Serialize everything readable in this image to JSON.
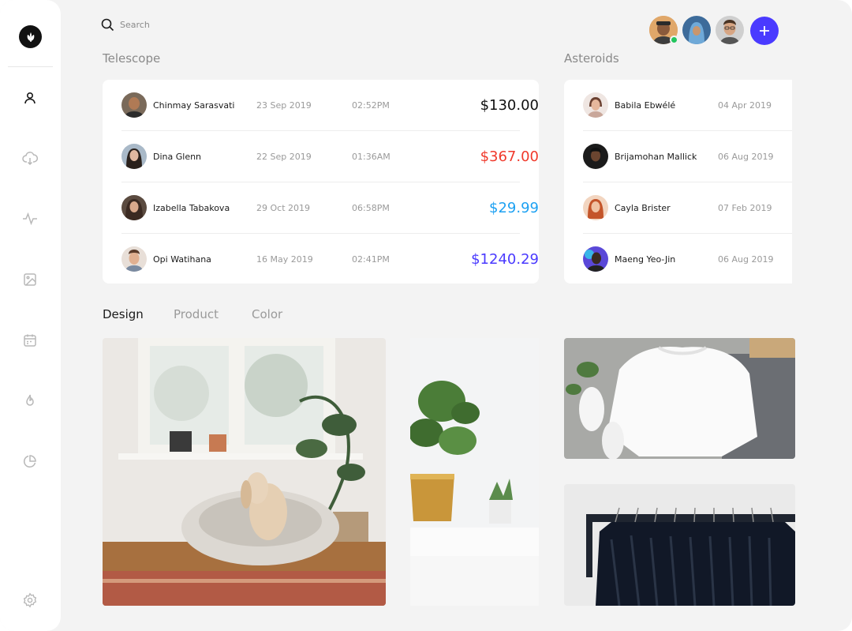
{
  "search": {
    "placeholder": "Search"
  },
  "sidebar": {
    "items": [
      {
        "icon": "user-icon"
      },
      {
        "icon": "cloud-download-icon"
      },
      {
        "icon": "activity-icon"
      },
      {
        "icon": "image-icon"
      },
      {
        "icon": "calendar-icon"
      },
      {
        "icon": "flame-icon"
      },
      {
        "icon": "pie-chart-icon"
      },
      {
        "icon": "settings-icon"
      }
    ]
  },
  "header": {
    "avatars": [
      "avatar-1",
      "avatar-2",
      "avatar-3"
    ],
    "add_icon": "plus-icon"
  },
  "telescope": {
    "title": "Telescope",
    "rows": [
      {
        "name": "Chinmay Sarasvati",
        "date": "23 Sep 2019",
        "time": "02:52PM",
        "amount": "$130.00",
        "color": "#111111"
      },
      {
        "name": "Dina Glenn",
        "date": "22 Sep 2019",
        "time": "01:36AM",
        "amount": "$367.00",
        "color": "#f0392b"
      },
      {
        "name": "Izabella Tabakova",
        "date": "29 Oct 2019",
        "time": "06:58PM",
        "amount": "$29.99",
        "color": "#1da1f2"
      },
      {
        "name": "Opi Watihana",
        "date": "16 May 2019",
        "time": "02:41PM",
        "amount": "$1240.29",
        "color": "#4a3aff"
      }
    ]
  },
  "asteroids": {
    "title": "Asteroids",
    "rows": [
      {
        "name": "Babila Ebwélé",
        "date": "04 Apr 2019"
      },
      {
        "name": "Brijamohan Mallick",
        "date": "06 Aug 2019"
      },
      {
        "name": "Cayla Brister",
        "date": "07 Feb 2019"
      },
      {
        "name": "Maeng Yeo-Jin",
        "date": "06 Aug 2019"
      }
    ]
  },
  "tabs": [
    {
      "label": "Design",
      "active": true
    },
    {
      "label": "Product",
      "active": false
    },
    {
      "label": "Color",
      "active": false
    }
  ],
  "colors": {
    "accent": "#4a3aff",
    "online": "#22c55e"
  }
}
